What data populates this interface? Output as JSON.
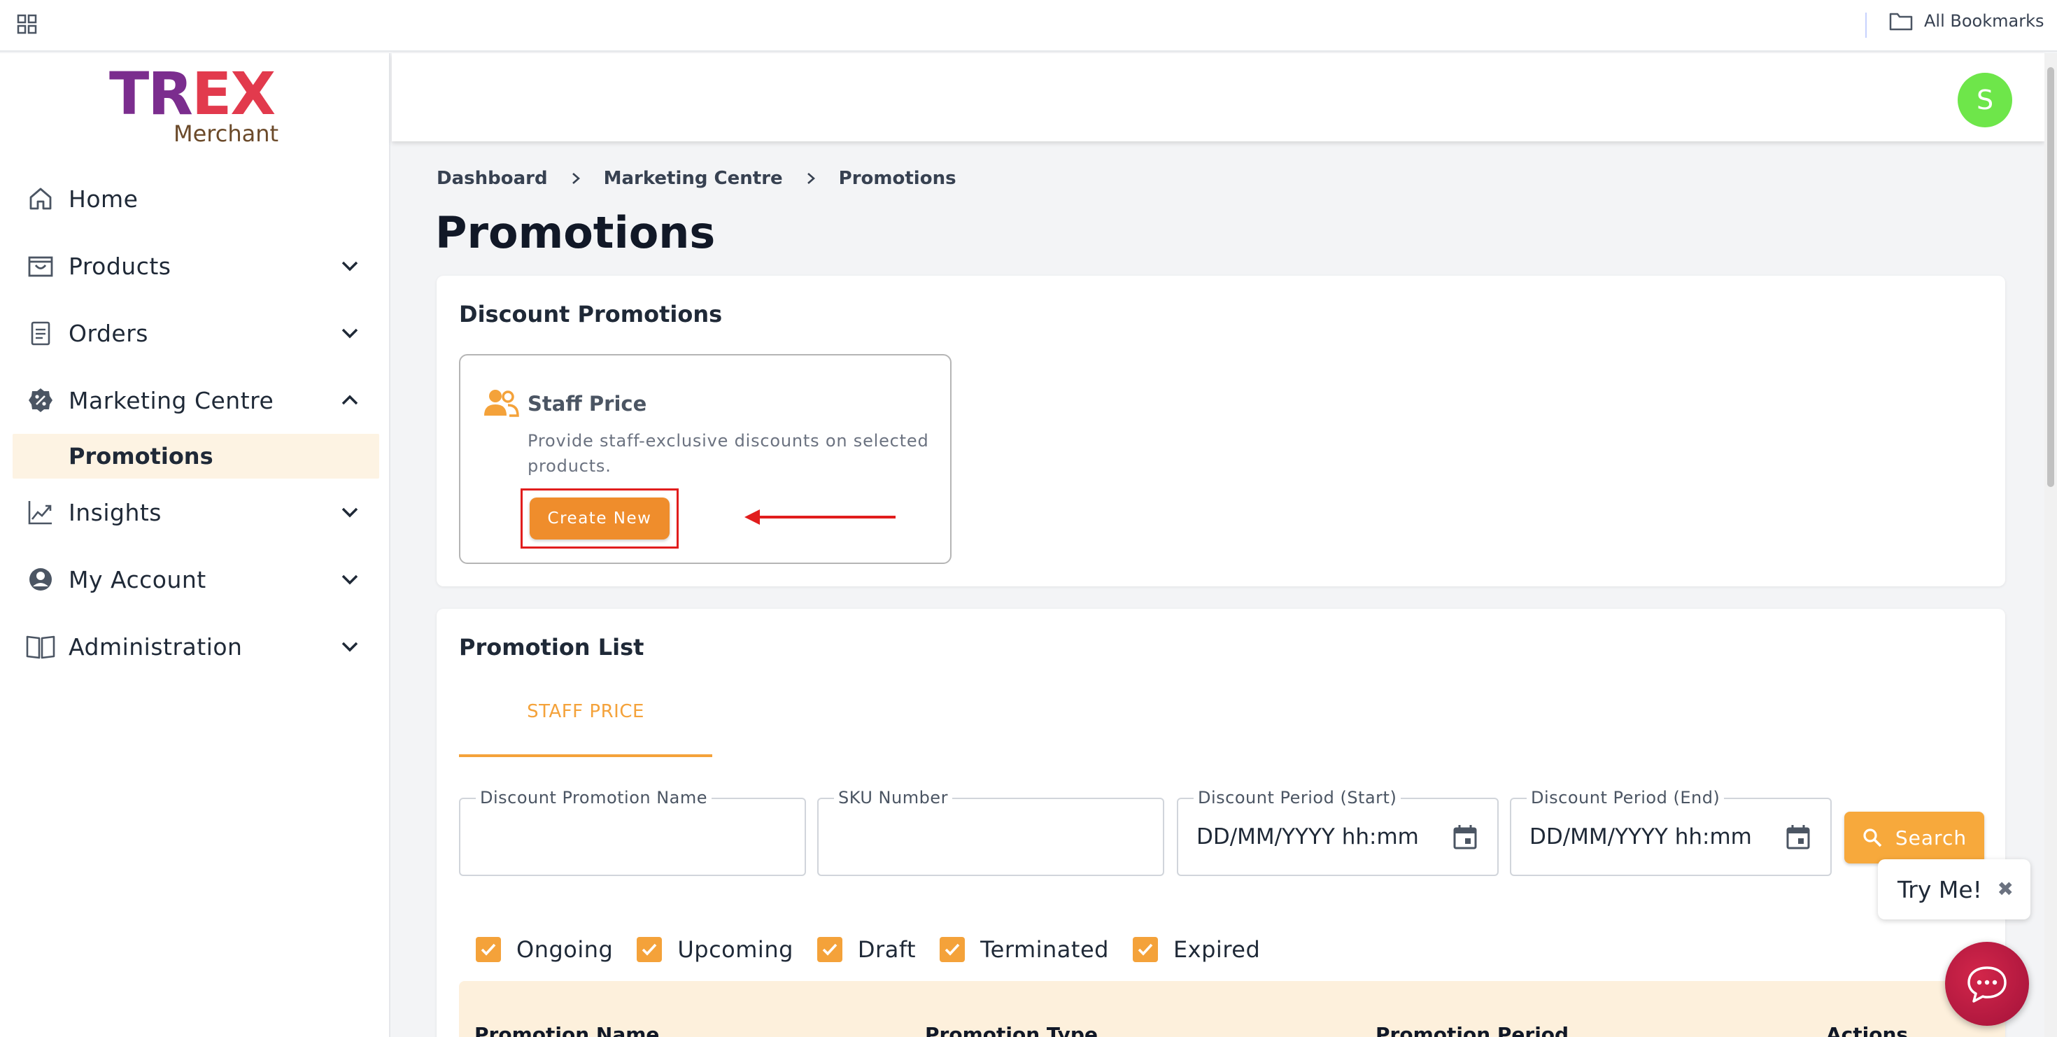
{
  "browser": {
    "bookmarks_label": "All Bookmarks"
  },
  "logo": {
    "text_part1": "TR",
    "text_part2": "EX",
    "sub": "Merchant"
  },
  "sidebar": {
    "items": [
      {
        "label": "Home",
        "icon": "home-icon",
        "has_chevron": false
      },
      {
        "label": "Products",
        "icon": "shopping-bag-icon",
        "has_chevron": true
      },
      {
        "label": "Orders",
        "icon": "clipboard-icon",
        "has_chevron": true
      },
      {
        "label": "Marketing Centre",
        "icon": "discount-badge-icon",
        "has_chevron": true,
        "expanded": true
      }
    ],
    "sub_item": {
      "label": "Promotions",
      "selected": true
    },
    "items_after": [
      {
        "label": "Insights",
        "icon": "trending-up-icon",
        "has_chevron": true
      },
      {
        "label": "My Account",
        "icon": "account-circle-icon",
        "has_chevron": true
      },
      {
        "label": "Administration",
        "icon": "book-icon",
        "has_chevron": true
      }
    ]
  },
  "header": {
    "avatar_letter": "S",
    "avatar_color": "#6ee64a"
  },
  "breadcrumb": [
    "Dashboard",
    "Marketing Centre",
    "Promotions"
  ],
  "page_title": "Promotions",
  "discount_promotions": {
    "title": "Discount Promotions",
    "card": {
      "title": "Staff Price",
      "description": "Provide staff-exclusive discounts on selected products.",
      "button_label": "Create New"
    }
  },
  "promotion_list": {
    "title": "Promotion List",
    "tab_label": "STAFF PRICE",
    "fields": {
      "name_label": "Discount Promotion Name",
      "sku_label": "SKU Number",
      "start_label": "Discount Period (Start)",
      "start_placeholder": "DD/MM/YYYY hh:mm",
      "end_label": "Discount Period (End)",
      "end_placeholder": "DD/MM/YYYY hh:mm"
    },
    "search_label": "Search",
    "statuses": [
      "Ongoing",
      "Upcoming",
      "Draft",
      "Terminated",
      "Expired"
    ],
    "columns": [
      "Promotion Name",
      "Promotion Type",
      "Promotion Period",
      "Actions"
    ]
  },
  "widget": {
    "try_me_label": "Try Me!",
    "close_glyph": "✖"
  },
  "colors": {
    "accent": "#f4a23a",
    "button": "#ef8d2c",
    "highlight_box": "#e11d1d",
    "chat": "#c21e44"
  }
}
